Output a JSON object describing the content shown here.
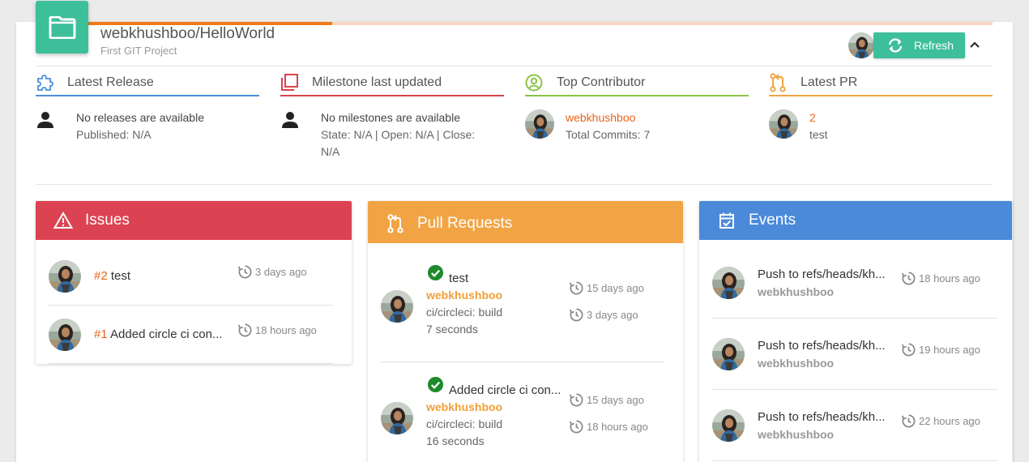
{
  "header": {
    "repo_name": "webkhushboo/HelloWorld",
    "repo_description": "First GIT Project",
    "refresh_label": "Refresh",
    "progress": 0.27,
    "colors": {
      "accent": "#3dbf9a",
      "progress": "#f07a18",
      "progress_track": "#f9d8c4"
    }
  },
  "stats": [
    {
      "title": "Latest Release",
      "icon": "puzzle-icon",
      "color": "#4a90d9",
      "line1": "No releases are available",
      "line2": "Published: N/A"
    },
    {
      "title": "Milestone last updated",
      "icon": "milestone-icon",
      "color": "#d9434e",
      "line1": "No milestones are available",
      "line2": "State: N/A | Open: N/A | Close:",
      "line3": "N/A"
    },
    {
      "title": "Top Contributor",
      "icon": "person-circle-icon",
      "color": "#8bc34a",
      "line1": "webkhushboo",
      "line2": "Total Commits: 7"
    },
    {
      "title": "Latest PR",
      "icon": "pull-request-icon",
      "color": "#f0a445",
      "line1": "2",
      "line2": "test"
    }
  ],
  "issues": {
    "title": "Issues",
    "color": "#dc4352",
    "items": [
      {
        "number": "#2",
        "title": "test",
        "time": "3 days ago"
      },
      {
        "number": "#1",
        "title": "Added circle ci con...",
        "time": "18 hours ago"
      }
    ]
  },
  "pull_requests": {
    "title": "Pull Requests",
    "color": "#f2a444",
    "items": [
      {
        "title": "test",
        "author": "webkhushboo",
        "check": "ci/circleci: build",
        "duration": "7 seconds",
        "created": "15 days ago",
        "updated": "3 days ago"
      },
      {
        "title": "Added circle ci con...",
        "author": "webkhushboo",
        "check": "ci/circleci: build",
        "duration": "16 seconds",
        "created": "15 days ago",
        "updated": "18 hours ago"
      }
    ]
  },
  "events": {
    "title": "Events",
    "color": "#4a8ad9",
    "items": [
      {
        "title": "Push to refs/heads/kh...",
        "author": "webkhushboo",
        "time": "18 hours ago"
      },
      {
        "title": "Push to refs/heads/kh...",
        "author": "webkhushboo",
        "time": "19 hours ago"
      },
      {
        "title": "Push to refs/heads/kh...",
        "author": "webkhushboo",
        "time": "22 hours ago"
      }
    ]
  }
}
